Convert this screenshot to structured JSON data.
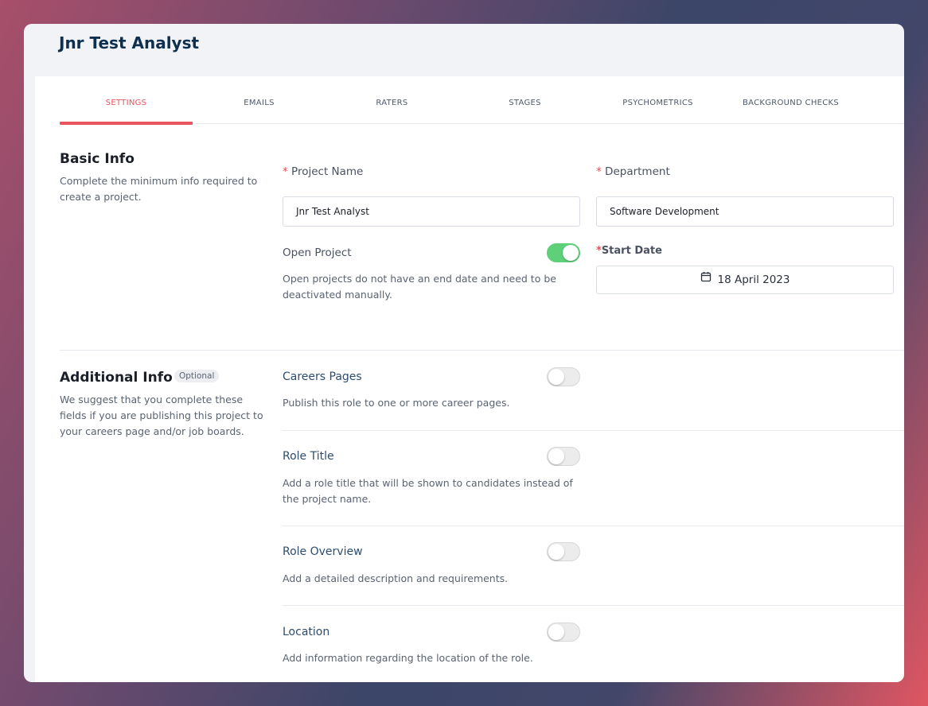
{
  "app": {
    "title": "Jnr Test Analyst"
  },
  "tabs": [
    {
      "label": "SETTINGS",
      "active": true
    },
    {
      "label": "EMAILS",
      "active": false
    },
    {
      "label": "RATERS",
      "active": false
    },
    {
      "label": "STAGES",
      "active": false
    },
    {
      "label": "PSYCHOMETRICS",
      "active": false
    },
    {
      "label": "BACKGROUND CHECKS",
      "active": false
    }
  ],
  "basic_info": {
    "title": "Basic Info",
    "description": "Complete the minimum info required to create a project.",
    "project_name": {
      "label": "Project Name",
      "value": "Jnr Test Analyst"
    },
    "department": {
      "label": "Department",
      "value": "Software Development"
    },
    "open_project": {
      "label": "Open Project",
      "enabled": true,
      "description": "Open projects do not have an end date and need to be deactivated manually."
    },
    "start_date": {
      "label": "Start Date",
      "value": "18 April 2023"
    }
  },
  "additional_info": {
    "title": "Additional Info",
    "badge": "Optional",
    "description": "We suggest that you complete these fields if you are publishing this project to your careers page and/or job boards.",
    "options": [
      {
        "label": "Careers Pages",
        "enabled": false,
        "description": "Publish this role to one or more career pages."
      },
      {
        "label": "Role Title",
        "enabled": false,
        "description": "Add a role title that will be shown to candidates instead of the project name."
      },
      {
        "label": "Role Overview",
        "enabled": false,
        "description": "Add a detailed description and requirements."
      },
      {
        "label": "Location",
        "enabled": false,
        "description": "Add information regarding the location of the role."
      }
    ]
  },
  "colors": {
    "accent": "#e9545e",
    "toggle_on": "#5fd07a",
    "title": "#0f2f4f",
    "link_label": "#2d4d6e"
  },
  "icons": {
    "calendar": "calendar-icon"
  }
}
